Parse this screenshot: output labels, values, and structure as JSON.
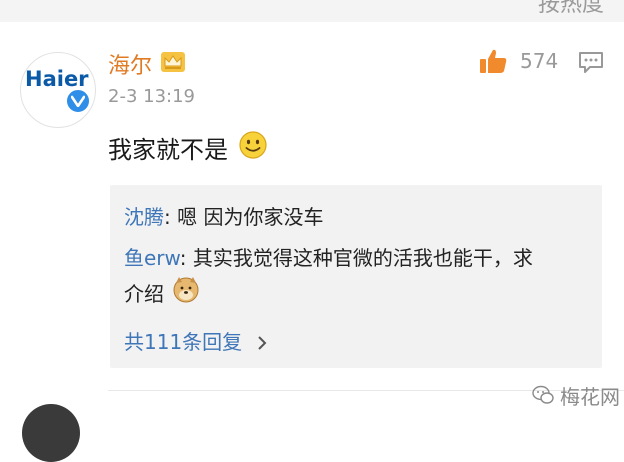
{
  "header": {
    "sort_label": "按热度"
  },
  "comment": {
    "avatar_text": "Haier",
    "username": "海尔",
    "timestamp": "2-3 13:19",
    "like_count": "574",
    "text": "我家就不是"
  },
  "replies": [
    {
      "user": "沈腾",
      "separator": ": ",
      "text": "嗯 因为你家没车"
    },
    {
      "user": "鱼erw",
      "separator": ": ",
      "text": "其实我觉得这种官微的活我也能干，求",
      "text_cont": "介绍"
    }
  ],
  "more_replies_label": "共111条回复",
  "watermark": {
    "text": "梅花网"
  },
  "colors": {
    "username": "#e07b24",
    "link": "#3f76b8",
    "verified": "#2f8fe8",
    "brand": "#0a5aa8"
  }
}
